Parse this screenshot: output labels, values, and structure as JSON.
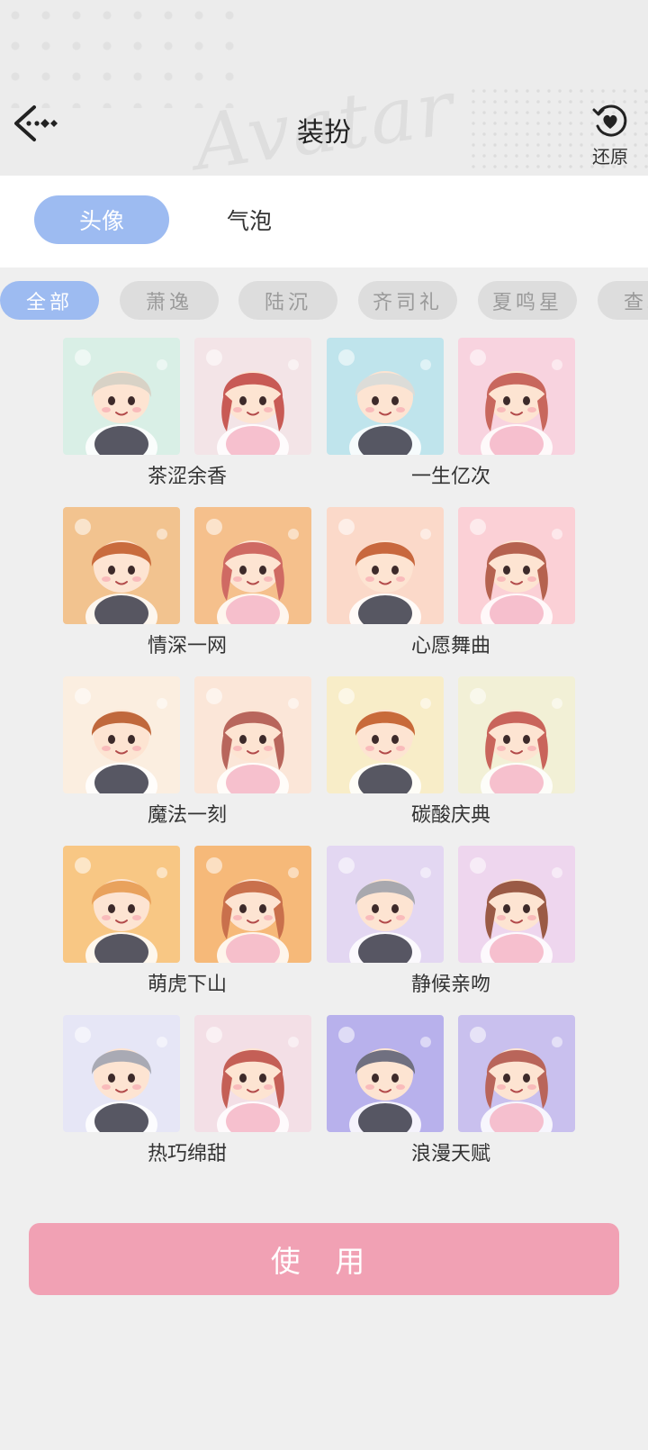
{
  "header": {
    "title": "装扮",
    "watermark": "Avatar",
    "restore_label": "还原",
    "back_icon": "back-arrow-icon",
    "restore_icon": "heart-restore-icon"
  },
  "main_tabs": [
    {
      "label": "头像",
      "active": true
    },
    {
      "label": "气泡",
      "active": false
    }
  ],
  "filter_chips": [
    {
      "label": "全部",
      "active": true
    },
    {
      "label": "萧逸",
      "active": false
    },
    {
      "label": "陆沉",
      "active": false
    },
    {
      "label": "齐司礼",
      "active": false
    },
    {
      "label": "夏鸣星",
      "active": false
    },
    {
      "label": "查理",
      "active": false
    }
  ],
  "avatars": [
    {
      "name": "茶涩余香"
    },
    {
      "name": "一生亿次"
    },
    {
      "name": "情深一网"
    },
    {
      "name": "心愿舞曲"
    },
    {
      "name": "魔法一刻"
    },
    {
      "name": "碳酸庆典"
    },
    {
      "name": "萌虎下山"
    },
    {
      "name": "静候亲吻"
    },
    {
      "name": "热巧绵甜"
    },
    {
      "name": "浪漫天赋"
    }
  ],
  "use_button_label": "使 用",
  "colors": {
    "accent_blue": "#9dbbf1",
    "use_button_pink": "#f1a1b4",
    "chip_inactive": "#dddddd",
    "background": "#efefef"
  }
}
